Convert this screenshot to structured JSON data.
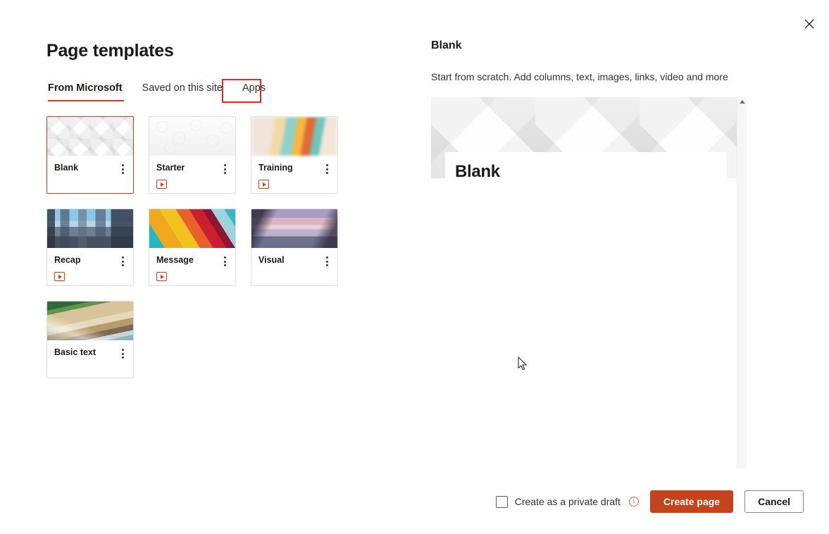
{
  "dialog": {
    "close_label": "Close",
    "title": "Page templates"
  },
  "tabs": [
    {
      "label": "From Microsoft",
      "active": true
    },
    {
      "label": "Saved on this site",
      "active": false
    },
    {
      "label": "Apps",
      "active": false,
      "highlighted": true
    }
  ],
  "templates": [
    {
      "label": "Blank",
      "selected": true,
      "has_video": false,
      "thumb": "th-blank"
    },
    {
      "label": "Starter",
      "selected": false,
      "has_video": true,
      "thumb": "th-starter"
    },
    {
      "label": "Training",
      "selected": false,
      "has_video": true,
      "thumb": "th-training"
    },
    {
      "label": "Recap",
      "selected": false,
      "has_video": true,
      "thumb": "th-recap"
    },
    {
      "label": "Message",
      "selected": false,
      "has_video": true,
      "thumb": "th-message"
    },
    {
      "label": "Visual",
      "selected": false,
      "has_video": false,
      "thumb": "th-visual"
    },
    {
      "label": "Basic text",
      "selected": false,
      "has_video": false,
      "thumb": "th-basictext"
    }
  ],
  "preview": {
    "title": "Blank",
    "description": "Start from scratch. Add columns, text, images, links, video and more",
    "page_heading": "Blank"
  },
  "footer": {
    "checkbox_label": "Create as a private draft",
    "checkbox_checked": false,
    "info_glyph": "i",
    "create_label": "Create page",
    "cancel_label": "Cancel"
  },
  "colors": {
    "accent": "#c4431a",
    "annotation": "#e8262a",
    "text": "#1b1a19"
  }
}
